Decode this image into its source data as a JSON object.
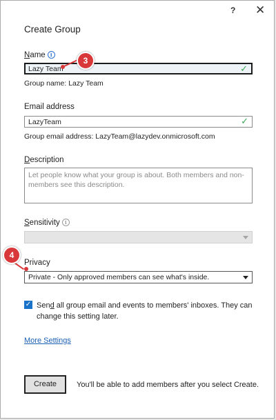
{
  "window": {
    "help_label": "?",
    "close_label": "✕",
    "title": "Create Group"
  },
  "name": {
    "label_prefix": "N",
    "label_rest": "ame",
    "info_icon": "i",
    "value": "Lazy Team",
    "hint": "Group name: Lazy Team",
    "valid_icon": "✓"
  },
  "email": {
    "label": "Email address",
    "value": "LazyTeam",
    "valid_icon": "✓",
    "hint": "Group email address: LazyTeam@lazydev.onmicrosoft.com"
  },
  "description": {
    "label_prefix": "D",
    "label_rest": "escription",
    "placeholder": "Let people know what your group is about. Both members and non-members see this description."
  },
  "sensitivity": {
    "label_prefix": "S",
    "label_rest": "ensitivity",
    "info_icon": "i",
    "value": ""
  },
  "privacy": {
    "label": "Privacy",
    "value": "Private - Only approved members can see what's inside."
  },
  "send_email": {
    "checked": true,
    "check_glyph": "✓",
    "label_prefix": "Sen",
    "label_u": "d",
    "label_rest": " all group email and events to members' inboxes. They can change this setting later."
  },
  "more_settings_label": "More Settings",
  "create_button_label": "Create",
  "create_note": "You'll be able to add members after you select Create.",
  "callouts": {
    "step_name": "3",
    "step_privacy": "4"
  },
  "colors": {
    "accent": "#1a73c9",
    "callout": "#d9383a",
    "valid": "#3aa655",
    "link": "#1a5fb4"
  }
}
